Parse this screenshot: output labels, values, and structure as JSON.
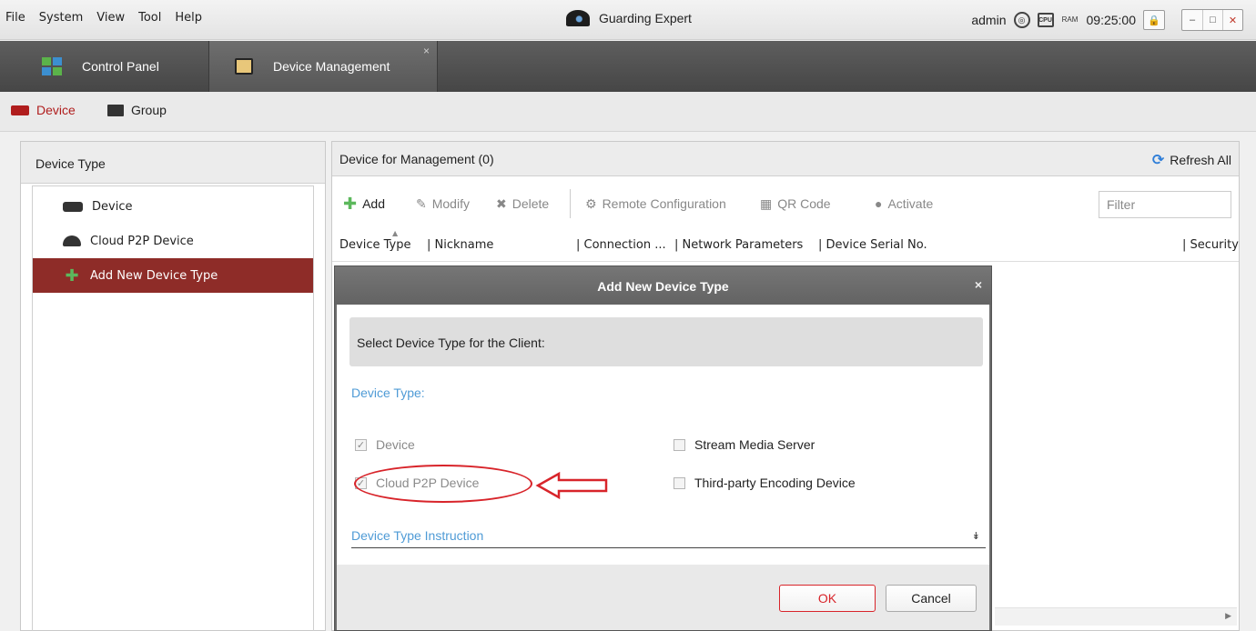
{
  "menu": [
    "File",
    "System",
    "View",
    "Tool",
    "Help"
  ],
  "app": {
    "title": "Guarding Expert"
  },
  "status": {
    "user": "admin",
    "time": "09:25:00",
    "cpu_label": "CPU",
    "ram_label": "RAM"
  },
  "tabs": [
    {
      "label": "Control Panel"
    },
    {
      "label": "Device Management",
      "close": "×"
    }
  ],
  "subtabs": [
    {
      "label": "Device"
    },
    {
      "label": "Group"
    }
  ],
  "left_panel": {
    "header": "Device Type",
    "items": [
      {
        "label": "Device"
      },
      {
        "label": "Cloud P2P Device"
      },
      {
        "label": "Add New Device Type"
      }
    ]
  },
  "right_panel": {
    "header": "Device for Management (0)",
    "refresh": "Refresh All",
    "toolbar": {
      "add": "Add",
      "modify": "Modify",
      "delete": "Delete",
      "remote_config": "Remote Configuration",
      "qr_code": "QR Code",
      "activate": "Activate",
      "filter_placeholder": "Filter"
    },
    "columns": [
      "Device Type",
      "| Nickname",
      "| Connection ...",
      "| Network Parameters",
      "| Device Serial No.",
      "| Security"
    ]
  },
  "dialog": {
    "title": "Add New Device Type",
    "close": "×",
    "section": "Select Device Type for the Client:",
    "device_type_label": "Device Type:",
    "options": [
      {
        "label": "Device",
        "checked": true,
        "disabled": true
      },
      {
        "label": "Cloud P2P Device",
        "checked": true,
        "disabled": true
      },
      {
        "label": "Stream Media Server",
        "checked": false,
        "disabled": false
      },
      {
        "label": "Third-party Encoding Device",
        "checked": false,
        "disabled": false
      }
    ],
    "instruction": "Device Type Instruction",
    "ok": "OK",
    "cancel": "Cancel"
  },
  "colors": {
    "accent_red": "#d8242a",
    "selected_bg": "#8e2c28",
    "link_blue": "#4f9bd6"
  }
}
